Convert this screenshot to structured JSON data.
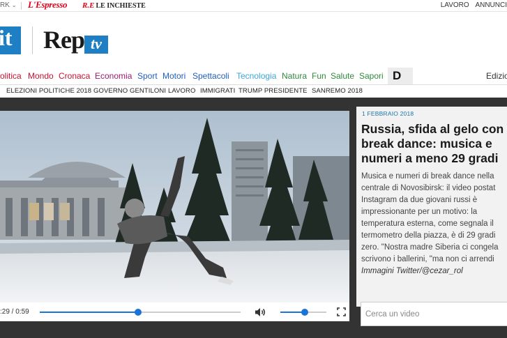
{
  "topbar": {
    "network_label": "RK",
    "espresso_logo": "L'Espresso",
    "inchieste_logo_prefix": "R.E",
    "inchieste_logo": "LE INCHIESTE",
    "links": [
      "LAVORO",
      "ANNUNCI"
    ]
  },
  "masthead": {
    "it_logo": "it",
    "rep_logo": "Rep",
    "tv_logo": "tv"
  },
  "sections": [
    {
      "label": "olitica",
      "color": "#c8102e"
    },
    {
      "label": "Mondo",
      "color": "#c8102e"
    },
    {
      "label": "Cronaca",
      "color": "#c8102e"
    },
    {
      "label": "Economia",
      "color": "#9b1b6e"
    },
    {
      "label": "Sport",
      "color": "#1f5fbf"
    },
    {
      "label": "Motori",
      "color": "#1f5fbf"
    },
    {
      "label": "Spettacoli",
      "color": "#1f5fbf"
    },
    {
      "label": "Tecnologia",
      "color": "#3aa6d9"
    },
    {
      "label": "Natura",
      "color": "#2e8b3a"
    },
    {
      "label": "Fun",
      "color": "#2e8b3a"
    },
    {
      "label": "Salute",
      "color": "#2e8b3a"
    },
    {
      "label": "Sapori",
      "color": "#2e8b3a"
    }
  ],
  "section_d": "D",
  "edizioni_label": "Edizio",
  "topics": [
    "ELEZIONI POLITICHE 2018",
    "GOVERNO GENTILONI",
    "LAVORO",
    "IMMIGRATI",
    "TRUMP PRESIDENTE",
    "SANREMO 2018"
  ],
  "player": {
    "time": ":29 / 0:59",
    "progress": 0.49,
    "volume": 0.53
  },
  "article": {
    "date": "1 FEBBRAIO 2018",
    "title_lines": [
      "Russia, sfida al gelo con",
      "break dance: musica e",
      "numeri a meno 29 gradi"
    ],
    "body_lines": [
      "Musica e numeri di break dance nella",
      "centrale di Novosibirsk: il video postat",
      "Instagram da due giovani russi è",
      "impressionante per un motivo: la",
      "temperatura esterna, come segnala il",
      "termometro della piazza, è di 29 gradi",
      "zero. \"Nostra madre Siberia ci congela",
      "scrivono i ballerini, \"ma non ci arrendi"
    ],
    "credit": "Immagini Twitter/@cezar_rol"
  },
  "search": {
    "placeholder": "Cerca un video"
  },
  "colors": {
    "accent_blue": "#1f7fc4",
    "player_blue": "#1a73d9",
    "stage_bg": "#333333"
  }
}
